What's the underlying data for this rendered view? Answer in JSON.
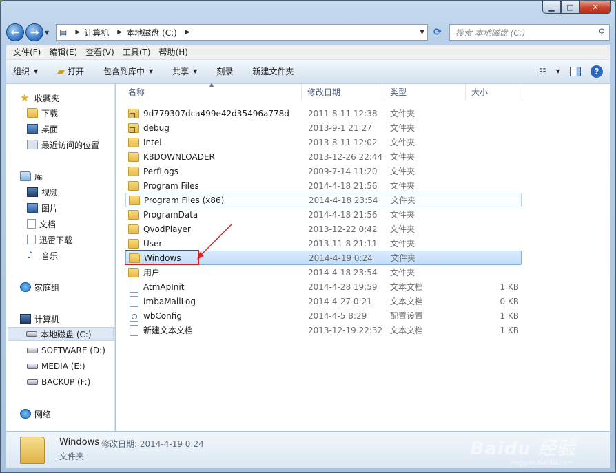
{
  "window": {
    "controls": {
      "minimize": "▁",
      "maximize": "□",
      "close": "✕"
    }
  },
  "address_bar": {
    "crumbs": [
      "计算机",
      "本地磁盘 (C:)"
    ],
    "search_placeholder": "搜索 本地磁盘 (C:)"
  },
  "menu": [
    "文件(F)",
    "编辑(E)",
    "查看(V)",
    "工具(T)",
    "帮助(H)"
  ],
  "toolbar": {
    "organize": "组织",
    "open": "打开",
    "include_in_library": "包含到库中",
    "share": "共享",
    "burn": "刻录",
    "new_folder": "新建文件夹"
  },
  "nav_pane": {
    "favorites": "收藏夹",
    "fav_items": [
      "下载",
      "桌面",
      "最近访问的位置"
    ],
    "libraries": "库",
    "lib_items": [
      "视频",
      "图片",
      "文档",
      "迅雷下载",
      "音乐"
    ],
    "homegroup": "家庭组",
    "computer": "计算机",
    "drives": [
      "本地磁盘 (C:)",
      "SOFTWARE (D:)",
      "MEDIA (E:)",
      "BACKUP (F:)"
    ],
    "network": "网络"
  },
  "columns": {
    "name": "名称",
    "date": "修改日期",
    "type": "类型",
    "size": "大小"
  },
  "files": [
    {
      "name": "9d779307dca499e42d35496a778d",
      "date": "2011-8-11 12:38",
      "type": "文件夹",
      "size": "",
      "icon": "locked-folder"
    },
    {
      "name": "debug",
      "date": "2013-9-1 21:27",
      "type": "文件夹",
      "size": "",
      "icon": "locked-folder"
    },
    {
      "name": "Intel",
      "date": "2013-8-11 12:02",
      "type": "文件夹",
      "size": "",
      "icon": "folder"
    },
    {
      "name": "K8DOWNLOADER",
      "date": "2013-12-26 22:44",
      "type": "文件夹",
      "size": "",
      "icon": "folder"
    },
    {
      "name": "PerfLogs",
      "date": "2009-7-14 11:20",
      "type": "文件夹",
      "size": "",
      "icon": "folder"
    },
    {
      "name": "Program Files",
      "date": "2014-4-18 21:56",
      "type": "文件夹",
      "size": "",
      "icon": "folder"
    },
    {
      "name": "Program Files (x86)",
      "date": "2014-4-18 23:54",
      "type": "文件夹",
      "size": "",
      "icon": "folder"
    },
    {
      "name": "ProgramData",
      "date": "2014-4-18 21:56",
      "type": "文件夹",
      "size": "",
      "icon": "folder"
    },
    {
      "name": "QvodPlayer",
      "date": "2013-12-22 0:42",
      "type": "文件夹",
      "size": "",
      "icon": "folder"
    },
    {
      "name": "User",
      "date": "2013-11-8 21:11",
      "type": "文件夹",
      "size": "",
      "icon": "folder"
    },
    {
      "name": "Windows",
      "date": "2014-4-19 0:24",
      "type": "文件夹",
      "size": "",
      "icon": "folder"
    },
    {
      "name": "用户",
      "date": "2014-4-18 23:54",
      "type": "文件夹",
      "size": "",
      "icon": "folder"
    },
    {
      "name": "AtmApInit",
      "date": "2014-4-28 19:59",
      "type": "文本文档",
      "size": "1 KB",
      "icon": "text-file"
    },
    {
      "name": "ImbaMallLog",
      "date": "2014-4-27 0:21",
      "type": "文本文档",
      "size": "0 KB",
      "icon": "text-file"
    },
    {
      "name": "wbConfig",
      "date": "2014-4-5 8:29",
      "type": "配置设置",
      "size": "1 KB",
      "icon": "config-file"
    },
    {
      "name": "新建文本文档",
      "date": "2013-12-19 22:32",
      "type": "文本文档",
      "size": "1 KB",
      "icon": "text-file"
    }
  ],
  "details_pane": {
    "name": "Windows",
    "modified_label": "修改日期: 2014-4-19 0:24",
    "type": "文件夹"
  },
  "watermark": {
    "brand": "Baidu 经验",
    "url": "jingyan.baidu.com"
  }
}
